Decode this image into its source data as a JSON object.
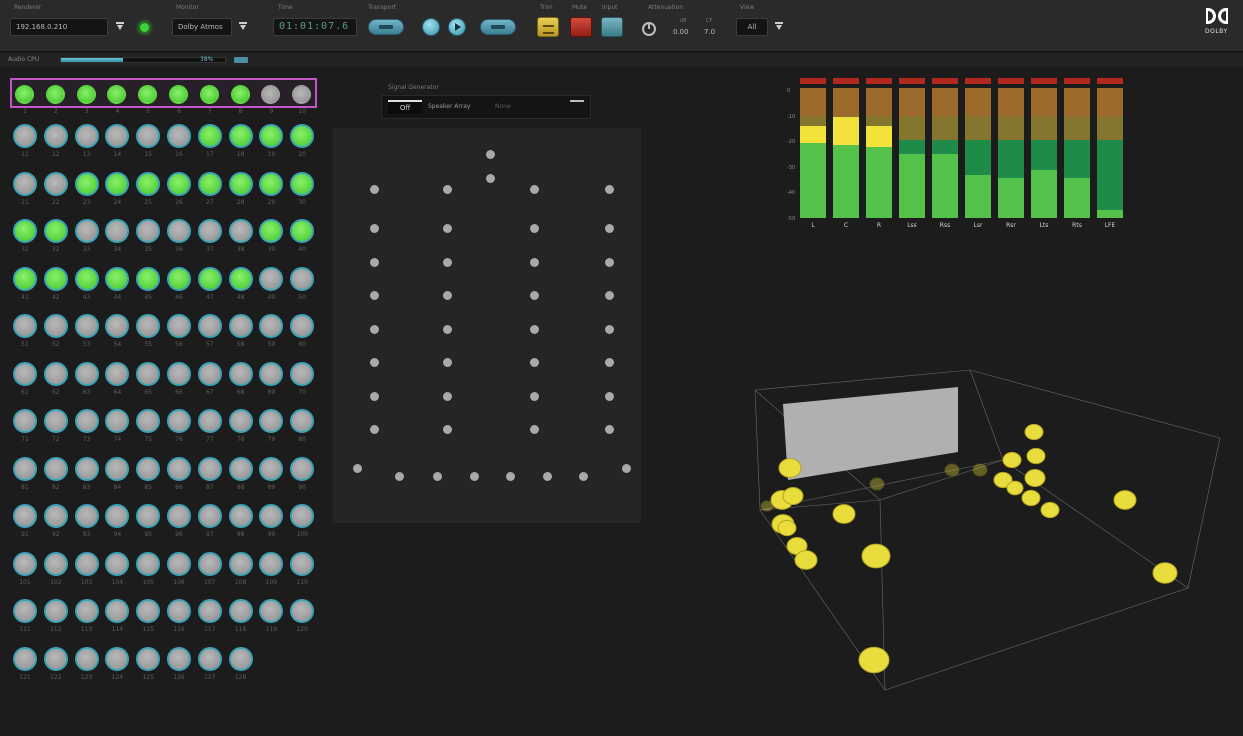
{
  "toolbar": {
    "renderer": {
      "label": "Renderer",
      "value": "192.168.0.210"
    },
    "monitor": {
      "label": "Monitor",
      "value": "Dolby Atmos"
    },
    "time": {
      "label": "Time",
      "value": "01:01:07.6"
    },
    "transport": {
      "label": "Transport"
    },
    "trim": {
      "label": "Trim"
    },
    "mute": {
      "label": "Mute"
    },
    "input": {
      "label": "Input"
    },
    "attenuation": {
      "label": "Attenuation",
      "db_label": "dB",
      "db_value": "0.00",
      "cf_label": "CF",
      "cf_value": "7.0"
    },
    "view": {
      "label": "View",
      "value": "All"
    },
    "brand": "DOLBY"
  },
  "cpu": {
    "label": "Audio CPU",
    "value": "38%",
    "level": 0.38
  },
  "objects": {
    "count": 128,
    "active": [
      1,
      2,
      3,
      4,
      5,
      6,
      7,
      8,
      17,
      18,
      19,
      20,
      23,
      24,
      25,
      26,
      27,
      28,
      29,
      30,
      31,
      32,
      39,
      40,
      41,
      42,
      43,
      44,
      45,
      46,
      47,
      48
    ]
  },
  "signal_generator": {
    "label": "Signal Generator",
    "toggle": "Off",
    "speaker_array_label": "Speaker Array",
    "speaker_array_value": "None"
  },
  "meters": {
    "scale": [
      "0",
      "-10",
      "-20",
      "-30",
      "-40",
      "-50"
    ],
    "channels": [
      {
        "name": "L",
        "level": 0.71,
        "yellow": 0.13
      },
      {
        "name": "C",
        "level": 0.78,
        "yellow": 0.22
      },
      {
        "name": "R",
        "level": 0.71,
        "yellow": 0.16
      },
      {
        "name": "Lss",
        "level": 0.49,
        "yellow": 0
      },
      {
        "name": "Rss",
        "level": 0.49,
        "yellow": 0
      },
      {
        "name": "Lsr",
        "level": 0.33,
        "yellow": 0
      },
      {
        "name": "Rsr",
        "level": 0.31,
        "yellow": 0
      },
      {
        "name": "Lts",
        "level": 0.37,
        "yellow": 0
      },
      {
        "name": "Rts",
        "level": 0.31,
        "yellow": 0
      },
      {
        "name": "LFE",
        "level": 0.06,
        "yellow": 0
      }
    ]
  }
}
